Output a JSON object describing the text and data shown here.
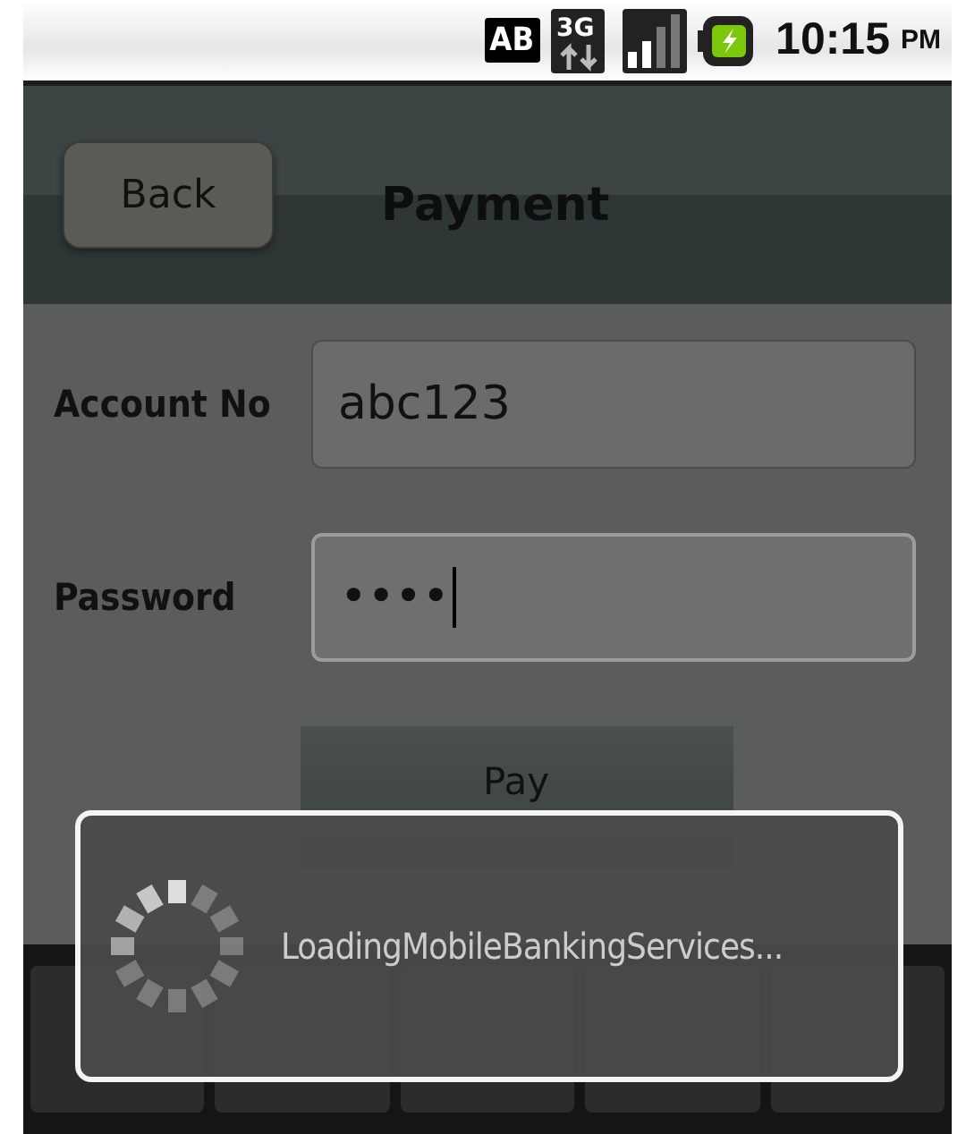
{
  "status_bar": {
    "badge": "AB",
    "network": "3G",
    "time": "10:15",
    "ampm": "PM"
  },
  "header": {
    "back_button": "Back",
    "title": "Payment"
  },
  "form": {
    "fields": [
      {
        "label": "Account No",
        "value": "abc123",
        "focused": false
      },
      {
        "label": "Password",
        "value": "••••",
        "focused": true
      }
    ],
    "submit": "Pay"
  },
  "dialog": {
    "message": "LoadingMobileBankingServices..."
  }
}
